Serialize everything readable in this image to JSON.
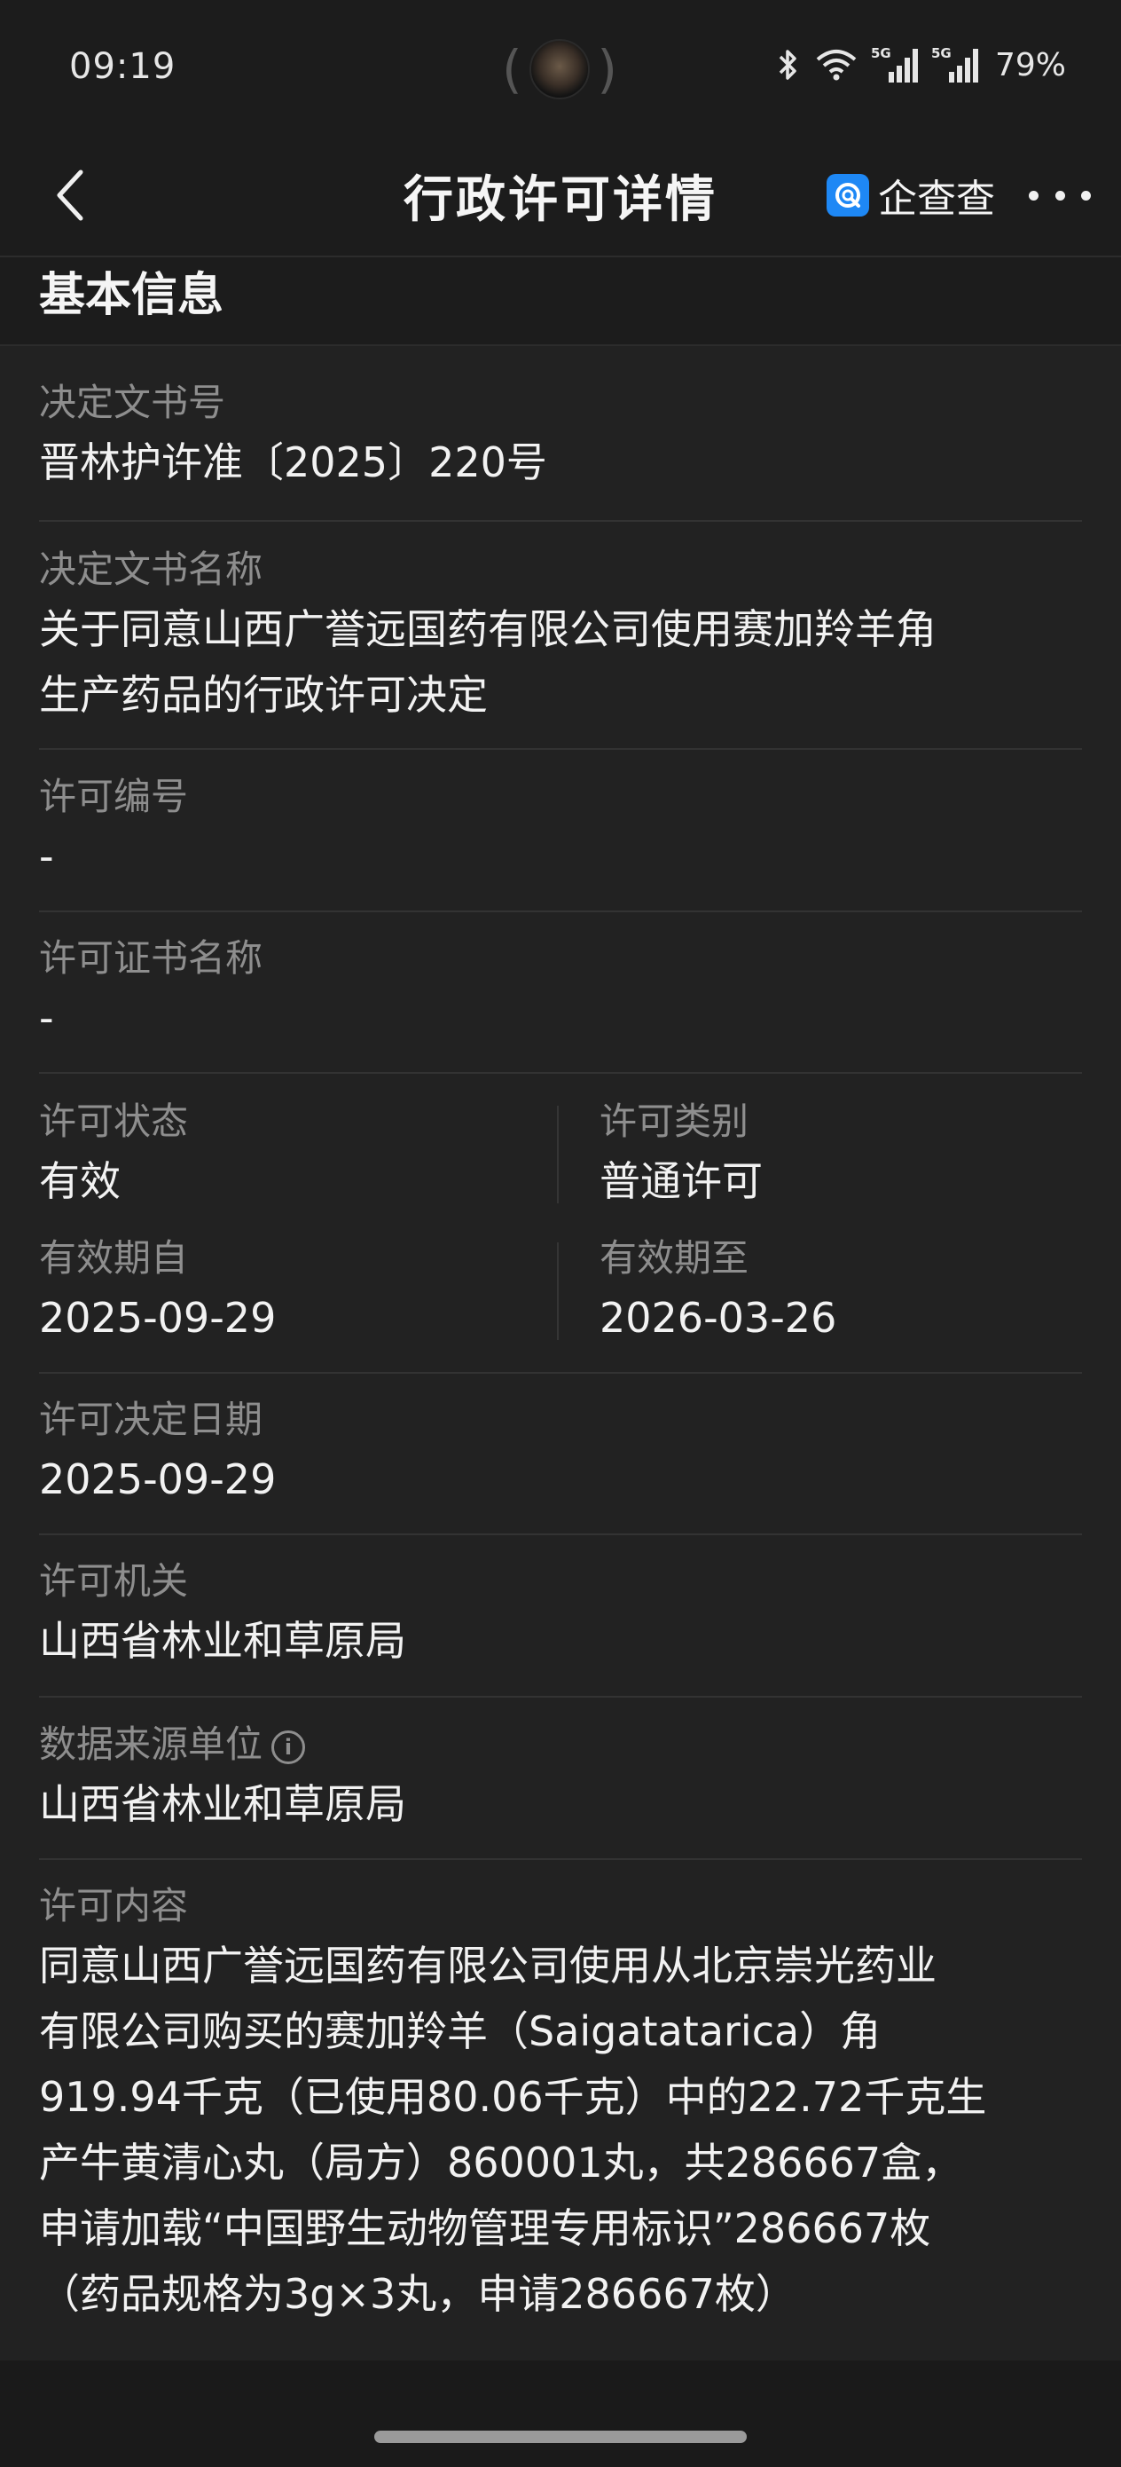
{
  "status_bar": {
    "time": "09:19",
    "icons": [
      "bluetooth-icon",
      "wifi-icon",
      "5g-signal-icon",
      "5g-signal-icon"
    ],
    "signal_label": "5G",
    "battery": "79%"
  },
  "header": {
    "title": "行政许可详情",
    "brand": "企查查",
    "brand_color": "#1e88f5"
  },
  "section": {
    "title": "基本信息"
  },
  "fields": {
    "decision_no": {
      "label": "决定文书号",
      "value": "晋林护许准〔2025〕220号"
    },
    "decision_name": {
      "label": "决定文书名称",
      "value_line1": "关于同意山西广誉远国药有限公司使用赛加羚羊角",
      "value_line2": "生产药品的行政许可决定"
    },
    "permit_no": {
      "label": "许可编号",
      "value": "-"
    },
    "cert_name": {
      "label": "许可证书名称",
      "value": "-"
    },
    "status": {
      "label": "许可状态",
      "value": "有效"
    },
    "category": {
      "label": "许可类别",
      "value": "普通许可"
    },
    "valid_from": {
      "label": "有效期自",
      "value": "2025-09-29"
    },
    "valid_to": {
      "label": "有效期至",
      "value": "2026-03-26"
    },
    "decision_date": {
      "label": "许可决定日期",
      "value": "2025-09-29"
    },
    "authority": {
      "label": "许可机关",
      "value": "山西省林业和草原局"
    },
    "data_source": {
      "label": "数据来源单位",
      "value": "山西省林业和草原局"
    },
    "content": {
      "label": "许可内容",
      "lines": [
        "同意山西广誉远国药有限公司使用从北京崇光药业",
        "有限公司购买的赛加羚羊（Saigatatarica）角",
        "919.94千克（已使用80.06千克）中的22.72千克生",
        "产牛黄清心丸（局方）860001丸，共286667盒，",
        "申请加载“中国野生动物管理专用标识”286667枚",
        "（药品规格为3g×3丸，申请286667枚）"
      ]
    }
  }
}
